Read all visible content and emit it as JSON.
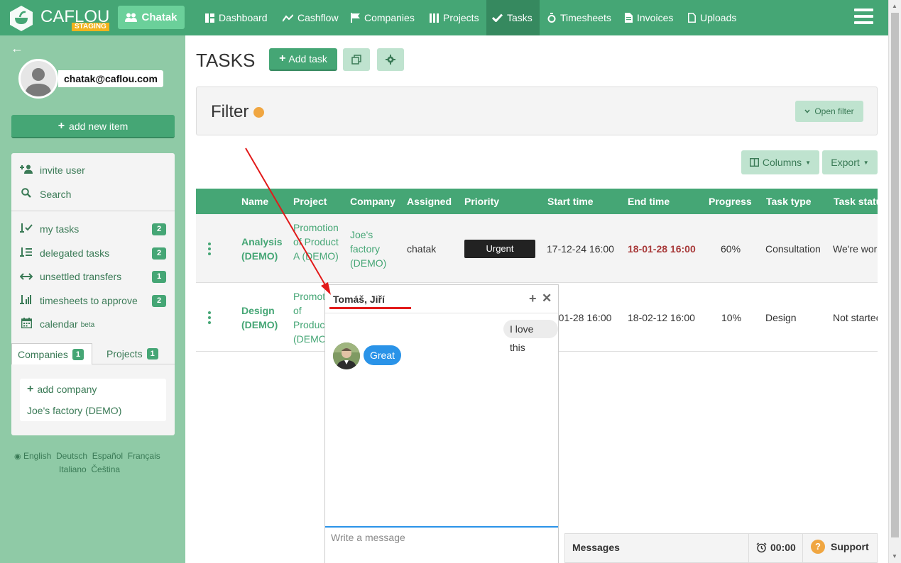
{
  "brand": {
    "name": "CAFLOU",
    "env_badge": "STAGING",
    "app_button": "Chatak"
  },
  "nav": {
    "items": [
      {
        "label": "Dashboard",
        "icon": "dashboard-icon"
      },
      {
        "label": "Cashflow",
        "icon": "cashflow-icon"
      },
      {
        "label": "Companies",
        "icon": "flag-icon"
      },
      {
        "label": "Projects",
        "icon": "columns-icon"
      },
      {
        "label": "Tasks",
        "icon": "check-icon",
        "active": true
      },
      {
        "label": "Timesheets",
        "icon": "stopwatch-icon"
      },
      {
        "label": "Invoices",
        "icon": "document-icon"
      },
      {
        "label": "Uploads",
        "icon": "file-icon"
      }
    ]
  },
  "sidebar": {
    "user_email": "chatak@caflou.com",
    "add_new": "add new item",
    "invite_user": "invite user",
    "search": "Search",
    "items": [
      {
        "label": "my tasks",
        "count": "2"
      },
      {
        "label": "delegated tasks",
        "count": "2"
      },
      {
        "label": "unsettled transfers",
        "count": "1"
      },
      {
        "label": "timesheets to approve",
        "count": "2"
      }
    ],
    "calendar": "calendar",
    "calendar_tag": "beta",
    "tabs": [
      {
        "label": "Companies",
        "count": "1"
      },
      {
        "label": "Projects",
        "count": "1"
      }
    ],
    "add_company": "add company",
    "company": "Joe's factory (DEMO)",
    "languages": [
      "English",
      "Deutsch",
      "Español",
      "Français",
      "Italiano",
      "Čeština"
    ]
  },
  "main": {
    "title": "TASKS",
    "add_task": "Add task",
    "filter_title": "Filter",
    "open_filter": "Open filter",
    "columns_btn": "Columns",
    "export_btn": "Export"
  },
  "table": {
    "headers": [
      "Name",
      "Project",
      "Company",
      "Assigned",
      "Priority",
      "Start time",
      "End time",
      "Progress",
      "Task type",
      "Task statu"
    ],
    "rows": [
      {
        "name": "Analysis (DEMO)",
        "project": "Promotion of Product A (DEMO)",
        "company": "Joe's factory (DEMO)",
        "assigned": "chatak",
        "priority": "Urgent",
        "start": "17-12-24 16:00",
        "end": "18-01-28 16:00",
        "progress": "60%",
        "type": "Consultation",
        "status": "We're wor"
      },
      {
        "name": "Design (DEMO)",
        "project": "Promot of Produc (DEMC",
        "company": "",
        "assigned": "",
        "priority": "",
        "start": "-01-28 16:00",
        "end": "18-02-12 16:00",
        "progress": "10%",
        "type": "Design",
        "status": "Not startec"
      }
    ]
  },
  "chat": {
    "contact": "Tomáš, Jiří",
    "messages": [
      {
        "from": "me",
        "text": "I love this"
      },
      {
        "from": "them",
        "text": "Great"
      }
    ],
    "input_placeholder": "Write a message"
  },
  "messages_bar": {
    "label": "Messages",
    "timer": "00:00",
    "support": "Support"
  },
  "colors": {
    "primary": "#45a675",
    "sidebar": "#8fcaa6",
    "urgent": "#222222",
    "overdue": "#a83a3a",
    "chat_accent": "#2a93e8",
    "annotation": "#e21a1a"
  }
}
